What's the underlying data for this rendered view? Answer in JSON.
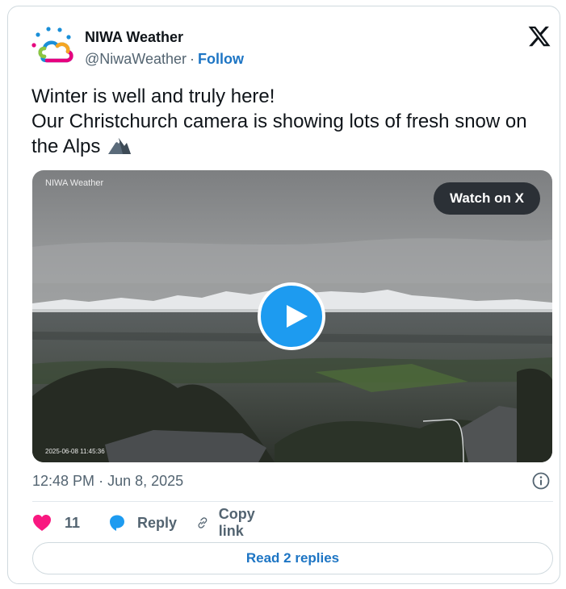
{
  "author": {
    "name": "NIWA Weather",
    "handle": "@NiwaWeather",
    "separator": "·",
    "follow_label": "Follow"
  },
  "tweet": {
    "lines": [
      "Winter is well and truly here!",
      "Our Christchurch camera is showing lots of fresh snow on",
      "the Alps"
    ],
    "emoji": "mountain-emoji"
  },
  "media": {
    "watermark": "NIWA Weather",
    "camera_timestamp": "2025-06-08 11:45:36",
    "watch_label": "Watch on X"
  },
  "meta": {
    "time": "12:48 PM",
    "separator": "·",
    "date": "Jun 8, 2025"
  },
  "actions": {
    "like_count": "11",
    "reply_label": "Reply",
    "copy_label": "Copy link"
  },
  "read_replies_label": "Read 2 replies",
  "colors": {
    "link": "#1d75c4",
    "play": "#1d9bf0",
    "heart": "#f91880",
    "muted": "#536471"
  }
}
